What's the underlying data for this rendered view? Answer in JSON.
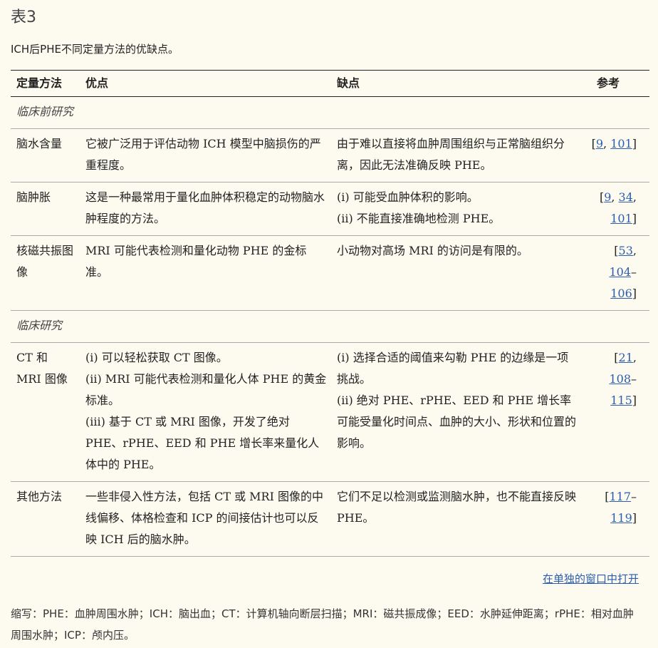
{
  "table_label": "表3",
  "caption": "ICH后PHE不同定量方法的优缺点。",
  "headers": {
    "method": "定量方法",
    "advantages": "优点",
    "disadvantages": "缺点",
    "references": "参考"
  },
  "sections": {
    "preclinical": "临床前研究",
    "clinical": "临床研究"
  },
  "rows": [
    {
      "method": "脑水含量",
      "advantages": [
        "它被广泛用于评估动物 ICH 模型中脑损伤的严重程度。"
      ],
      "disadvantages": [
        "由于难以直接将血肿周围组织与正常脑组织分离，因此无法准确反映 PHE。"
      ],
      "refs": [
        "[",
        "9",
        ", ",
        "101",
        "]"
      ]
    },
    {
      "method": "脑肿胀",
      "advantages": [
        "这是一种最常用于量化血肿体积稳定的动物脑水肿程度的方法。"
      ],
      "disadvantages": [
        "(i) 可能受血肿体积的影响。",
        "(ii) 不能直接准确地检测 PHE。"
      ],
      "refs": [
        "[",
        "9",
        ", ",
        "34",
        ", ",
        "101",
        "]"
      ]
    },
    {
      "method": "核磁共振图像",
      "advantages": [
        "MRI 可能代表检测和量化动物 PHE 的金标准。"
      ],
      "disadvantages": [
        "小动物对高场 MRI 的访问是有限的。"
      ],
      "refs": [
        "[",
        "53",
        ", ",
        "104",
        "–",
        "106",
        "]"
      ]
    },
    {
      "method": "CT 和 MRI 图像",
      "advantages": [
        "(i) 可以轻松获取 CT 图像。",
        "(ii) MRI 可能代表检测和量化人体 PHE 的黄金标准。",
        "(iii) 基于 CT 或 MRI 图像，开发了绝对 PHE、rPHE、EED 和 PHE 增长率来量化人体中的 PHE。"
      ],
      "disadvantages": [
        "(i) 选择合适的阈值来勾勒 PHE 的边缘是一项挑战。",
        "(ii) 绝对 PHE、rPHE、EED 和 PHE 增长率可能受量化时间点、血肿的大小、形状和位置的影响。"
      ],
      "refs": [
        "[",
        "21",
        ", ",
        "108",
        "–",
        "115",
        "]"
      ]
    },
    {
      "method": "其他方法",
      "advantages": [
        "一些非侵入性方法，包括 CT 或 MRI 图像的中线偏移、体格检查和 ICP 的间接估计也可以反映 ICH 后的脑水肿。"
      ],
      "disadvantages": [
        "它们不足以检测或监测脑水肿，也不能直接反映 PHE。"
      ],
      "refs": [
        "[",
        "117",
        "–",
        "119",
        "]"
      ]
    }
  ],
  "open_link": "在单独的窗口中打开",
  "footnote": "缩写：PHE：血肿周围水肿；ICH：脑出血；CT：计算机轴向断层扫描；MRI：磁共振成像；EED：水肿延伸距离；rPHE：相对血肿周围水肿；ICP：颅内压。"
}
